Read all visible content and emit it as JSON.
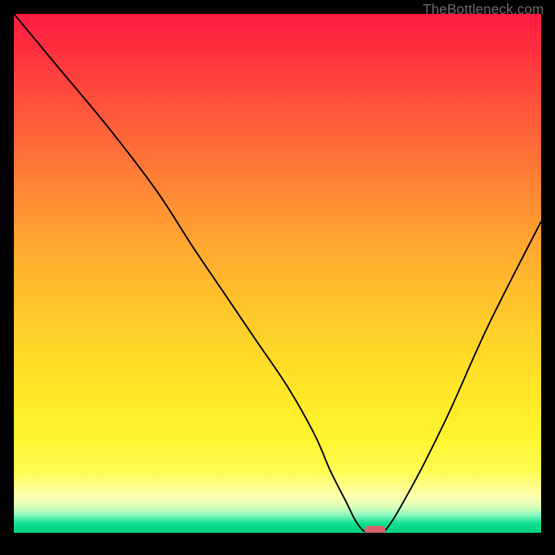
{
  "watermark_text": "TheBottleneck.com",
  "marker_color": "#d9616a",
  "line_color": "#000000",
  "line_width": 2.2,
  "chart_data": {
    "type": "line",
    "title": "",
    "xlabel": "",
    "ylabel": "",
    "xlim": [
      0,
      100
    ],
    "ylim": [
      0,
      100
    ],
    "grid": false,
    "legend": false,
    "series": [
      {
        "name": "curve",
        "x": [
          0,
          9,
          18,
          27,
          34,
          40,
          46,
          52,
          57,
          60,
          63,
          65,
          67,
          70,
          75,
          82,
          90,
          100
        ],
        "y": [
          100,
          89,
          78,
          66,
          55,
          46,
          37,
          28,
          19,
          12,
          6,
          2,
          0,
          0,
          8,
          22,
          40,
          60
        ]
      }
    ],
    "marker": {
      "x": 68.5,
      "y": 0,
      "shape": "rounded-rect"
    },
    "gradient_stops": [
      {
        "pos": 0.0,
        "color": "#ff1a3f"
      },
      {
        "pos": 0.5,
        "color": "#ffc22c"
      },
      {
        "pos": 0.88,
        "color": "#fffc50"
      },
      {
        "pos": 0.97,
        "color": "#40e9a8"
      },
      {
        "pos": 1.0,
        "color": "#06d486"
      }
    ]
  }
}
